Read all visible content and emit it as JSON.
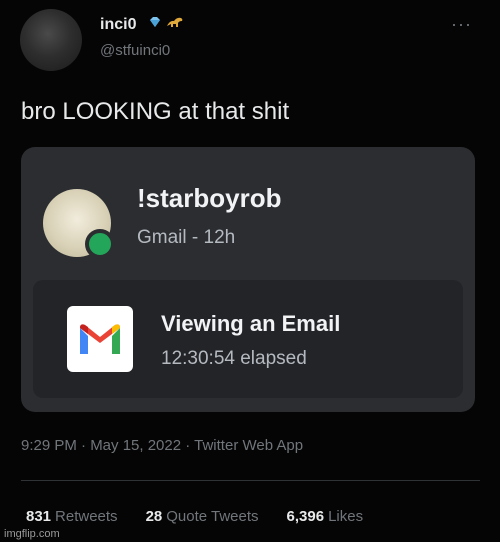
{
  "tweet": {
    "display_name": "inci0",
    "badges": [
      "gem-emoji",
      "dinosaur-emoji"
    ],
    "handle": "@stfuinci0",
    "more_label": "···",
    "text": "bro LOOKING at that shit",
    "timestamp": "9:29 PM · May 15, 2022 · Twitter Web App",
    "stats": {
      "retweets_count": "831",
      "retweets_label": "Retweets",
      "quotes_count": "28",
      "quotes_label": "Quote Tweets",
      "likes_count": "6,396",
      "likes_label": "Likes"
    }
  },
  "embed": {
    "username": "!starboyrob",
    "subtext": "Gmail - 12h",
    "activity_title": "Viewing an Email",
    "activity_time": "12:30:54 elapsed",
    "status_color": "#23a55a",
    "app_icon": "gmail-icon"
  },
  "watermark": "imgflip.com"
}
